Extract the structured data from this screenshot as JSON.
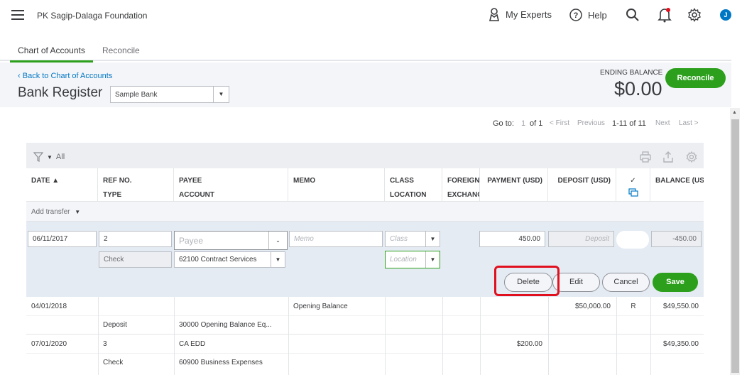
{
  "topbar": {
    "company": "PK Sagip-Dalaga Foundation",
    "my_experts": "My Experts",
    "help": "Help",
    "avatar_initial": "J"
  },
  "tabs": [
    {
      "label": "Chart of Accounts"
    },
    {
      "label": "Reconcile"
    }
  ],
  "header": {
    "back_link": "Back to Chart of Accounts",
    "title": "Bank Register",
    "account": "Sample Bank",
    "ending_balance_label": "ENDING BALANCE",
    "ending_balance_value": "$0.00",
    "reconcile_label": "Reconcile"
  },
  "pager": {
    "goto": "Go to:",
    "page": "1",
    "of": "of 1",
    "first": "< First",
    "previous": "Previous",
    "range": "1-11 of 11",
    "next": "Next",
    "last": "Last >"
  },
  "toolbar": {
    "filter_label": "All"
  },
  "columns": {
    "date": "DATE ▲",
    "ref_no": "REF NO.",
    "type": "TYPE",
    "payee": "PAYEE",
    "account": "ACCOUNT",
    "memo": "MEMO",
    "class": "CLASS",
    "location": "LOCATION",
    "foreign": "FOREIGN",
    "exchange": "EXCHANG",
    "payment": "PAYMENT (USD)",
    "deposit": "DEPOSIT (USD)",
    "check": "✓",
    "balance": "BALANCE (USD"
  },
  "add_transfer": "Add transfer",
  "edit_row": {
    "date": "06/11/2017",
    "ref_no": "2",
    "payee_placeholder": "Payee",
    "memo_placeholder": "Memo",
    "class_placeholder": "Class",
    "payment": "450.00",
    "deposit_placeholder": "Deposit",
    "balance": "-450.00",
    "type": "Check",
    "account": "62100 Contract Services",
    "location_placeholder": "Location",
    "buttons": {
      "delete": "Delete",
      "edit": "Edit",
      "cancel": "Cancel",
      "save": "Save"
    }
  },
  "rows": [
    {
      "date": "04/01/2018",
      "ref_no": "",
      "type": "Deposit",
      "payee": "",
      "account": "30000 Opening Balance Eq...",
      "memo": "Opening Balance",
      "payment": "",
      "deposit": "$50,000.00",
      "check": "R",
      "balance": "$49,550.00"
    },
    {
      "date": "07/01/2020",
      "ref_no": "3",
      "type": "Check",
      "payee": "CA EDD",
      "account": "60900 Business Expenses",
      "memo": "",
      "payment": "$200.00",
      "deposit": "",
      "check": "",
      "balance": "$49,350.00"
    }
  ],
  "colors": {
    "accent_green": "#2ca01c",
    "link_blue": "#0077c5",
    "highlight_red": "#e0101f"
  }
}
